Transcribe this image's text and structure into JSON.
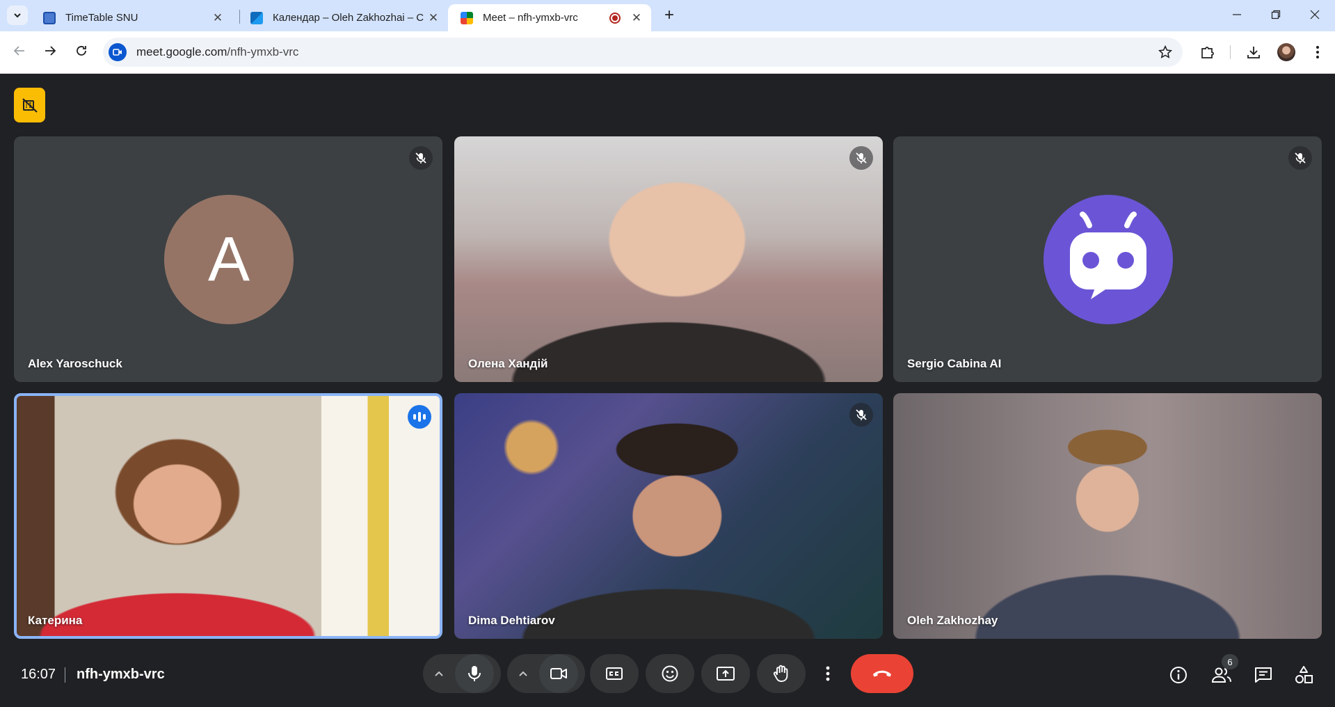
{
  "browser": {
    "tabs": [
      {
        "title": "TimeTable SNU",
        "favicon": "timetable-icon",
        "active": false
      },
      {
        "title": "Календар – Oleh Zakhozhai – C",
        "favicon": "calendar-icon",
        "active": false
      },
      {
        "title": "Meet – nfh-ymxb-vrc",
        "favicon": "meet-icon",
        "active": true,
        "recording": true
      }
    ],
    "url_host": "meet.google.com",
    "url_path": "/nfh-ymxb-vrc"
  },
  "meet": {
    "recording_badge_icon": "no-camera-icon",
    "participants": [
      {
        "name": "Alex Yaroschuck",
        "muted": true,
        "avatar_letter": "A",
        "avatar_color": "#957466"
      },
      {
        "name": "Олена Хандій",
        "muted": true
      },
      {
        "name": "Sergio Cabina AI",
        "muted": true,
        "avatar_color": "#6b55d6"
      },
      {
        "name": "Катерина",
        "muted": false,
        "speaking": true
      },
      {
        "name": "Dima Dehtiarov",
        "muted": true
      },
      {
        "name": "Oleh Zakhozhay",
        "muted": false
      }
    ],
    "time": "16:07",
    "meeting_code": "nfh-ymxb-vrc",
    "participant_count": "6",
    "colors": {
      "end_call": "#ea4335",
      "speaking_border": "#8ab4f8",
      "badge": "#fbbc04"
    }
  }
}
